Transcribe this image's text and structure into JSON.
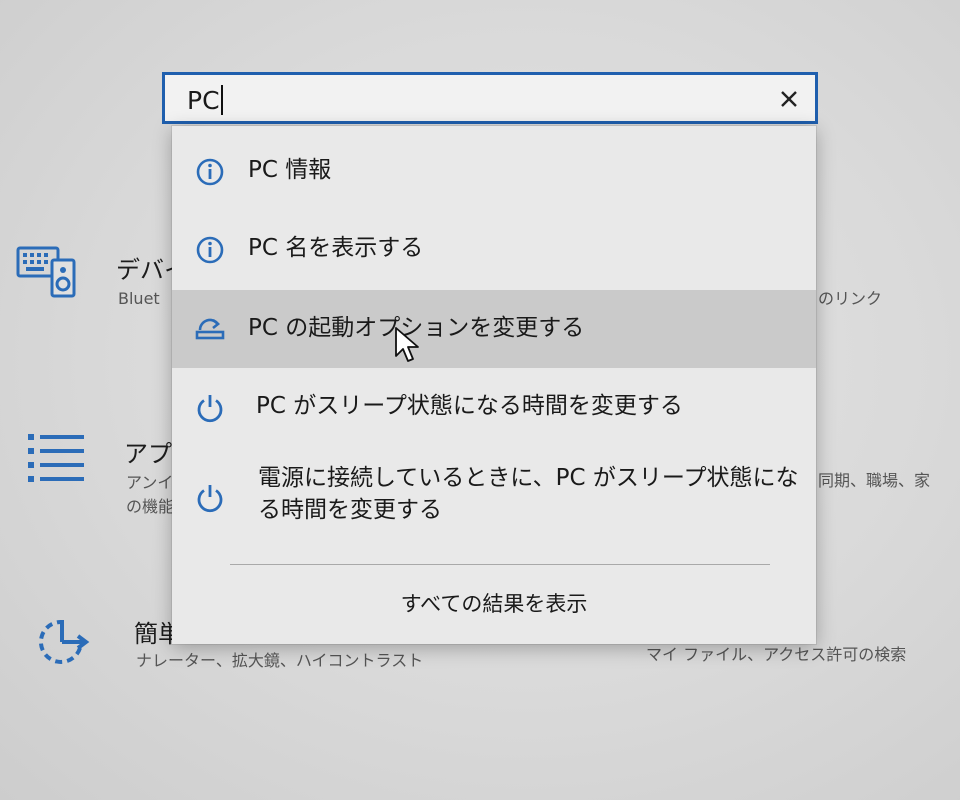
{
  "search": {
    "value": "PC",
    "clear_icon": "close-icon"
  },
  "results": [
    {
      "label": "PC 情報",
      "icon": "info-icon"
    },
    {
      "label": "PC 名を表示する",
      "icon": "info-icon"
    },
    {
      "label": "PC の起動オプションを変更する",
      "icon": "startup-icon",
      "highlighted": true
    },
    {
      "label": "PC がスリープ状態になる時間を変更する",
      "icon": "power-icon"
    },
    {
      "label": "電源に接続しているときに、PC がスリープ状態になる時間を変更する",
      "icon": "power-icon"
    }
  ],
  "show_all_label": "すべての結果を表示",
  "background": {
    "devices": {
      "title": "デバイ",
      "desc": "Bluet",
      "desc_right": "のリンク"
    },
    "apps": {
      "title": "アプリ",
      "desc_line1": "アンイ",
      "desc_line2": "の機能",
      "desc_right": "同期、職場、家"
    },
    "ease": {
      "title": "簡単",
      "desc": "ナレーター、拡大鏡、ハイコントラスト"
    },
    "privacy": {
      "desc": "マイ ファイル、アクセス許可の検索"
    }
  },
  "colors": {
    "accent": "#1f5fae",
    "icon_blue": "#2b6cb8",
    "highlight": "#cacaca"
  }
}
